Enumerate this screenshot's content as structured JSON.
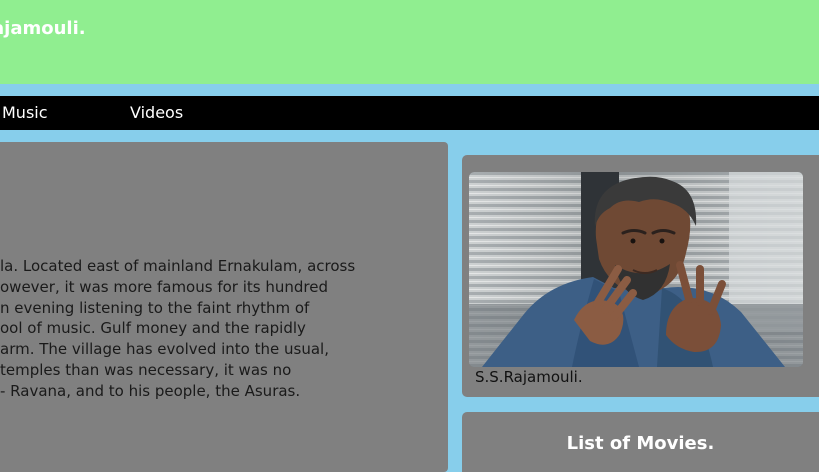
{
  "header": {
    "title": "ajamouli."
  },
  "nav": {
    "items": [
      {
        "label": "Music"
      },
      {
        "label": "Videos"
      }
    ]
  },
  "article": {
    "lines": [
      "la. Located east of mainland Ernakulam, across",
      "owever, it was more famous for its hundred",
      "n evening listening to the faint rhythm of",
      "ool of music. Gulf money and the rapidly",
      "arm. The village has evolved into the usual,",
      " temples than was necessary, it was no",
      "- Ravana, and to his people, the Asuras."
    ]
  },
  "profile": {
    "caption": "S.S.Rajamouli."
  },
  "movies": {
    "title": "List of Movies."
  },
  "colors": {
    "page_background": "#87ceeb",
    "header_background": "#90ee90",
    "nav_background": "#000000",
    "panel_background": "#808080",
    "title_text": "#ffffff"
  }
}
